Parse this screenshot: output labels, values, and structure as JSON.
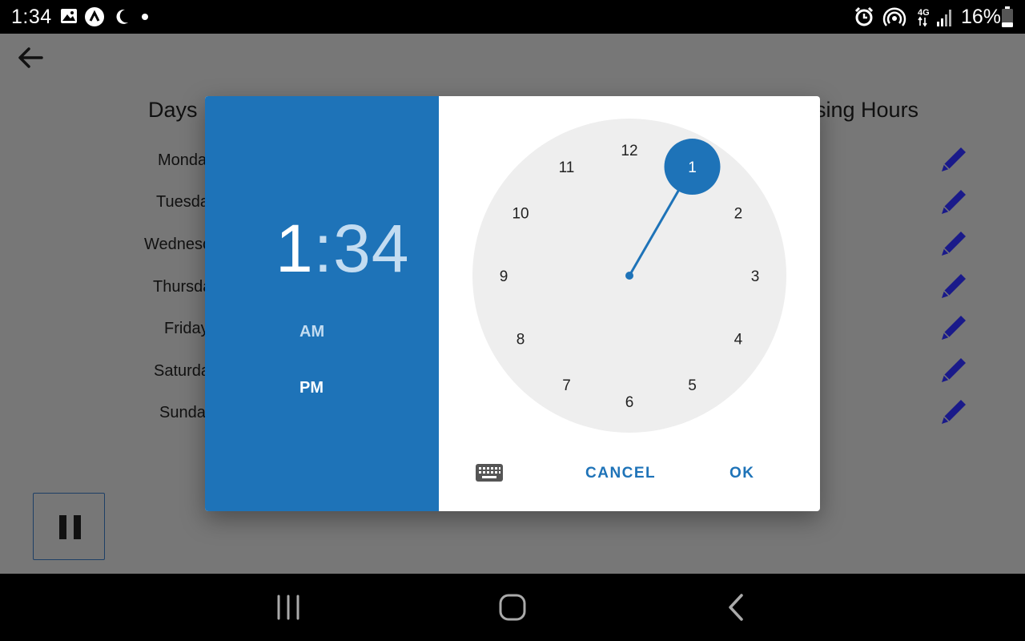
{
  "status_bar": {
    "time": "1:34",
    "battery": "16%",
    "network": "4G",
    "left_icons": [
      "image-icon",
      "app-icon",
      "do-not-disturb-icon",
      "dot-icon"
    ],
    "right_icons": [
      "alarm-icon",
      "hotspot-icon",
      "signal-icon",
      "battery-icon"
    ]
  },
  "app": {
    "header_days": "Days",
    "header_closing": "sing Hours",
    "days": [
      "Monda",
      "Tuesda",
      "Wednesc",
      "Thursda",
      "Friday",
      "Saturda",
      "Sunda"
    ],
    "edit_icon": "pencil-icon",
    "pause_icon": "pause-icon"
  },
  "time_picker": {
    "hour": "1",
    "separator": ":",
    "minute": "34",
    "am_label": "AM",
    "pm_label": "PM",
    "selected_period": "PM",
    "selected_hour": 1,
    "dial_numbers": [
      "12",
      "1",
      "2",
      "3",
      "4",
      "5",
      "6",
      "7",
      "8",
      "9",
      "10",
      "11"
    ],
    "cancel_label": "CANCEL",
    "ok_label": "OK",
    "keyboard_icon": "keyboard-icon",
    "accent_color": "#1e73b8",
    "dial_color": "#eeeeee"
  },
  "nav_bar": {
    "icons": [
      "recent-apps-icon",
      "home-icon",
      "back-icon"
    ]
  }
}
